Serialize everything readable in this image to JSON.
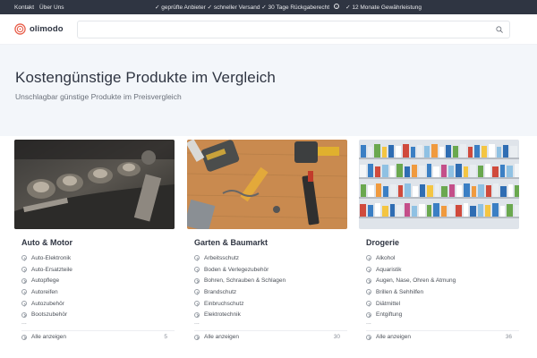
{
  "topbar": {
    "links": [
      "Kontakt",
      "Über Uns"
    ],
    "benefit_1": "✓ geprüfte Anbieter ✓ schneller Versand ✓ 30 Tage Rückgaberecht",
    "info_glyph": "i",
    "benefit_2": "✓ 12 Monate Gewährleistung"
  },
  "header": {
    "logo_text": "olimodo",
    "search_placeholder": "",
    "icons": {
      "logo": "olimodo-logo-icon",
      "search": "search-icon"
    }
  },
  "hero": {
    "title": "Kostengünstige Produkte im Vergleich",
    "subtitle": "Unschlagbar günstige Produkte im Preisvergleich"
  },
  "categories": [
    {
      "title": "Auto & Motor",
      "items": [
        "Auto-Elektronik",
        "Auto-Ersatzteile",
        "Autopflege",
        "Autoreifen",
        "Autozubehör",
        "Bootszubehör"
      ],
      "more": "...",
      "footer_label": "Alle anzeigen",
      "count": "5"
    },
    {
      "title": "Garten & Baumarkt",
      "items": [
        "Arbeitsschutz",
        "Boden & Verlegezubehör",
        "Bohren, Schrauben & Schlagen",
        "Brandschutz",
        "Einbruchschutz",
        "Elektrotechnik"
      ],
      "more": "...",
      "footer_label": "Alle anzeigen",
      "count": "30"
    },
    {
      "title": "Drogerie",
      "items": [
        "Alkohol",
        "Aquaristik",
        "Augen, Nase, Ohren & Atmung",
        "Brillen & Sehhilfen",
        "Diätmittel",
        "Entgiftung"
      ],
      "more": "...",
      "footer_label": "Alle anzeigen",
      "count": "36"
    }
  ],
  "colors": {
    "topbar_bg": "#2f3542",
    "hero_bg": "#f3f6fa",
    "brand": "#e8604c"
  }
}
